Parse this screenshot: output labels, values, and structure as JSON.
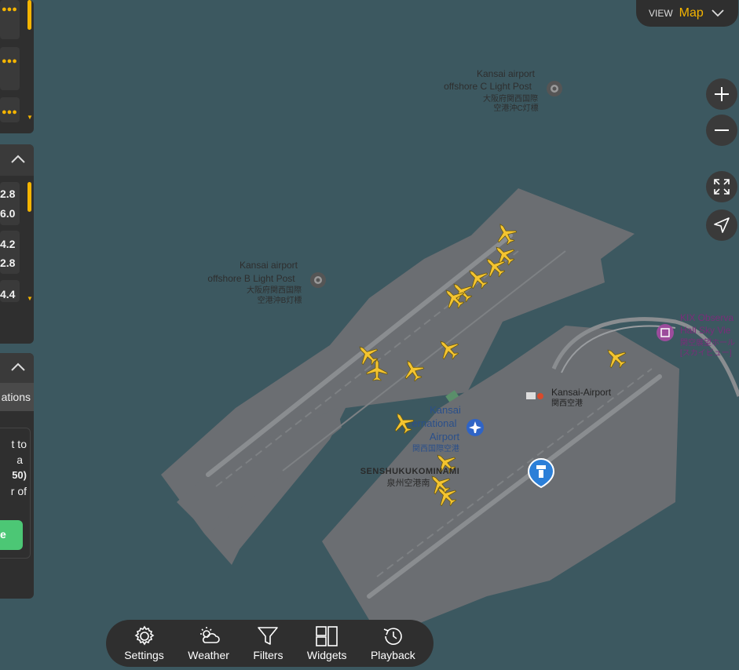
{
  "view": {
    "prefix": "VIEW",
    "value": "Map"
  },
  "controls": {
    "zoom_in": "+",
    "zoom_out": "−"
  },
  "left_panel": {
    "numbers_top": [
      "2.8",
      "6.0"
    ],
    "numbers_mid": [
      "4.2",
      "2.8"
    ],
    "number_bottom": "4.4",
    "tab_label": "ations",
    "message_lines": [
      "t to",
      "a",
      "50)",
      "r of"
    ],
    "button_label": "e"
  },
  "map_labels": {
    "c_light": [
      "Kansai airport",
      "offshore C Light Post",
      "大阪府関西国際",
      "空港沖C灯標"
    ],
    "b_light": [
      "Kansai airport",
      "offshore B Light Post",
      "大阪府関西国際",
      "空港沖B灯標"
    ],
    "kix_obs": [
      "KIX Observa",
      "Hall Sky Vie",
      "関空展望ホール",
      "[スカイビュー]"
    ],
    "station": [
      "Kansai-Airport",
      "関西空港"
    ],
    "airport": [
      "Kansai",
      "ernational",
      "Airport",
      "関西国際空港"
    ],
    "district": [
      "SENSHUKUKOMINAMI",
      "泉州空港南"
    ]
  },
  "bottom_bar": {
    "settings": "Settings",
    "weather": "Weather",
    "filters": "Filters",
    "widgets": "Widgets",
    "playback": "Playback"
  },
  "colors": {
    "sea": "#3c5860",
    "land": "#6e7174",
    "plane": "#f4c430",
    "panel": "#2f2f2f",
    "accent": "#f4b400",
    "button_green": "#4cc775"
  }
}
